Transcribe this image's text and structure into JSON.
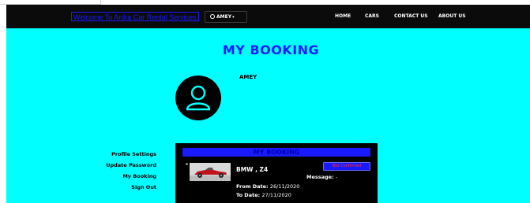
{
  "navbar": {
    "brand": "Welcome To Ardra Car Rental Services",
    "user_menu": {
      "label": "AMEY",
      "icon": "user-circle-icon",
      "caret_icon": "chevron-down-icon"
    },
    "links": [
      "HOME",
      "CARS",
      "CONTACT US",
      "ABOUT US"
    ],
    "background": "#0b0b0b"
  },
  "main": {
    "background": "#00ffff",
    "title": "MY BOOKING",
    "profile": {
      "name": "AMEY",
      "avatar_icon": "user-icon"
    },
    "sidebar": [
      "Profile Settings",
      "Update Password",
      "My Booking",
      "Sign Out"
    ],
    "booking_panel": {
      "header": "MY BOOKING",
      "car": {
        "name": "BMW , Z4",
        "image": "red-convertible-car"
      },
      "status": "Not Confirmed",
      "message_label": "Message:",
      "message_value": "-",
      "from_label": "From Date:",
      "from_value": "26/11/2020",
      "to_label": "To Date:",
      "to_value": "27/11/2020"
    }
  },
  "colors": {
    "accent": "#1a1aff",
    "status_text": "#ff3333"
  }
}
